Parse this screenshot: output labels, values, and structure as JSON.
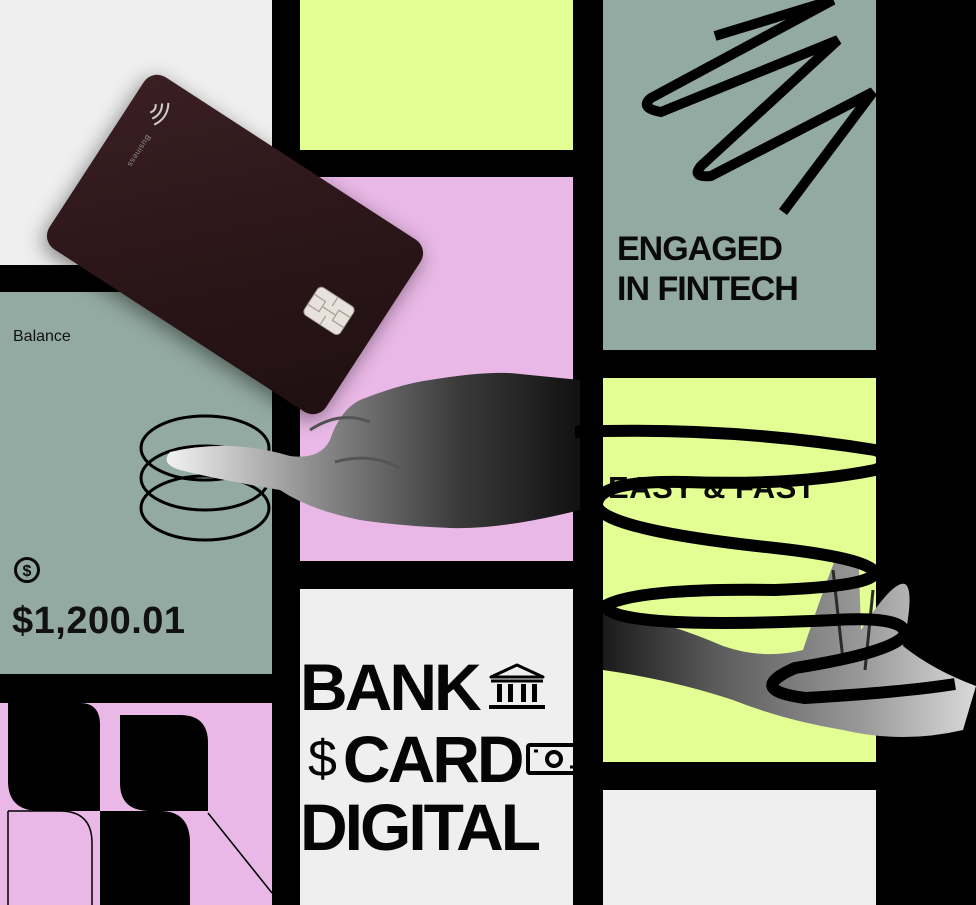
{
  "balance_panel": {
    "label": "Balance",
    "currency_symbol": "$",
    "amount": "$1,200.01"
  },
  "card": {
    "brand_text": "Business"
  },
  "headlines": {
    "engaged": [
      "ENGAGED",
      "IN FINTECH"
    ],
    "easy": "EASY & FAST"
  },
  "bank_block": {
    "line1": "BANK",
    "line2_prefix": "$",
    "line2": "CARD",
    "line3": "DIGITAL"
  },
  "colors": {
    "background": "#000000",
    "light_gray": "#efefef",
    "lime": "#e3fe92",
    "pink": "#e9b8e6",
    "sage": "#93aaa2",
    "card": "#2b1518"
  },
  "icons": [
    "dollar-circle-icon",
    "bank-icon",
    "banknote-icon",
    "contactless-icon",
    "chip-icon"
  ]
}
